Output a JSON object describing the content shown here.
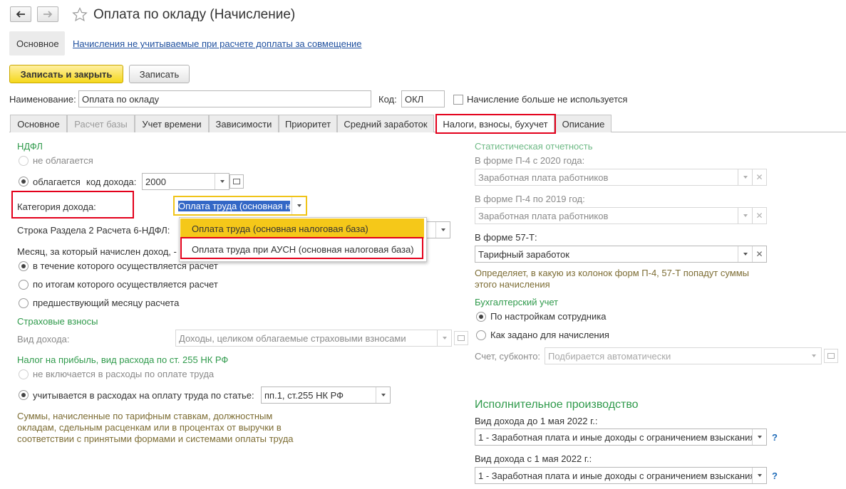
{
  "window": {
    "title": "Оплата по окладу (Начисление)"
  },
  "top_nav": {
    "main_label": "Основное",
    "link_label": "Начисления не учитываемые при расчете доплаты за совмещение"
  },
  "toolbar": {
    "save_close_label": "Записать и закрыть",
    "save_label": "Записать"
  },
  "header": {
    "name_label": "Наименование:",
    "name_value": "Оплата по окладу",
    "code_label": "Код:",
    "code_value": "ОКЛ",
    "unused_label": "Начисление больше не используется"
  },
  "tabs": [
    {
      "label": "Основное"
    },
    {
      "label": "Расчет базы"
    },
    {
      "label": "Учет времени"
    },
    {
      "label": "Зависимости"
    },
    {
      "label": "Приоритет"
    },
    {
      "label": "Средний заработок"
    },
    {
      "label": "Налоги, взносы, бухучет"
    },
    {
      "label": "Описание"
    }
  ],
  "left": {
    "ndfl_header": "НДФЛ",
    "not_taxed_label": "не облагается",
    "taxed_label": "облагается",
    "income_code_label": "код дохода:",
    "income_code_value": "2000",
    "income_category_label": "Категория дохода:",
    "income_category_value": "Оплата труда (основная н",
    "section2_label": "Строка Раздела 2 Расчета 6-НДФЛ:",
    "month_label": "Месяц, за который начислен доход, -",
    "month_options": [
      "в течение которого осуществляется расчет",
      "по итогам которого осуществляется расчет",
      "предшествующий месяцу расчета"
    ],
    "insurance_header": "Страховые взносы",
    "income_type_label": "Вид дохода:",
    "income_type_value": "Доходы, целиком облагаемые страховыми взносами",
    "profit_tax_header": "Налог на прибыль, вид расхода по ст. 255 НК РФ",
    "not_included_label": "не включается в расходы по оплате труда",
    "included_label": "учитывается в расходах на оплату труда по статье:",
    "article_value": "пп.1, ст.255 НК РФ",
    "note": "Суммы, начисленные по тарифным ставкам, должностным окладам, сдельным расценкам или в процентах от выручки в соответствии с принятыми формами и системами оплаты труда"
  },
  "dropdown": {
    "options": [
      "Оплата труда (основная налоговая база)",
      "Оплата труда при АУСН (основная налоговая база)"
    ]
  },
  "right": {
    "stat_header": "Статистическая отчетность",
    "p4_2020_label": "В форме П-4 с 2020 года:",
    "p4_2020_value": "Заработная плата работников",
    "p4_2019_label": "В форме П-4 по 2019 год:",
    "p4_2019_value": "Заработная плата работников",
    "f57_label": "В форме 57-Т:",
    "f57_value": "Тарифный заработок",
    "f57_note": "Определяет, в какую из колонок форм П-4, 57-Т попадут суммы этого начисления",
    "accounting_header": "Бухгалтерский учет",
    "acc_option1": "По настройкам сотрудника",
    "acc_option2": "Как задано для начисления",
    "account_label": "Счет, субконто:",
    "account_placeholder": "Подбирается автоматически",
    "enforcement_header": "Исполнительное производство",
    "before_label": "Вид дохода до 1 мая 2022 г.:",
    "before_value": "1 - Заработная плата и иные доходы с ограничением взыскания",
    "after_label": "Вид дохода с 1 мая 2022 г.:",
    "after_value": "1 - Заработная плата и иные доходы с ограничением взыскания",
    "help": "?"
  }
}
